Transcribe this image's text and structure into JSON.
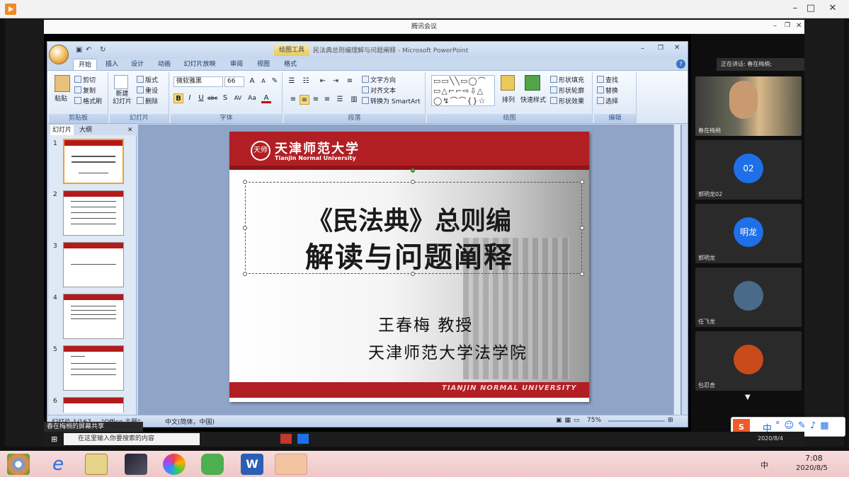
{
  "meeting": {
    "title": "腾讯会议"
  },
  "ppt": {
    "ctx_tab": "绘图工具",
    "doc_title": "民法典总则编理解与问题阐释 - Microsoft PowerPoint",
    "tabs": [
      "开始",
      "插入",
      "设计",
      "动画",
      "幻灯片放映",
      "审阅",
      "视图",
      "格式"
    ],
    "clipboard": {
      "paste": "粘贴",
      "cut": "剪切",
      "copy": "复制",
      "painter": "格式刷",
      "label": "剪贴板"
    },
    "slides": {
      "new": "新建\n幻灯片",
      "layout": "版式",
      "reset": "重设",
      "delete": "删除",
      "label": "幻灯片"
    },
    "font": {
      "name": "微软雅黑",
      "size": "66",
      "label": "字体"
    },
    "paragraph": {
      "dir": "文字方向",
      "align": "对齐文本",
      "smartart": "转换为 SmartArt",
      "label": "段落"
    },
    "drawing": {
      "arrange": "排列",
      "quick": "快速样式",
      "fill": "形状填充",
      "outline": "形状轮廓",
      "effect": "形状效果",
      "label": "绘图"
    },
    "editing": {
      "find": "查找",
      "replace": "替换",
      "select": "选择",
      "label": "编辑"
    },
    "panel_tabs": [
      "幻灯片",
      "大纲"
    ],
    "thumbs": [
      "1",
      "2",
      "3",
      "4",
      "5",
      "6"
    ],
    "status": {
      "slide": "幻灯片 1/167",
      "theme": "\"Office 主题\"",
      "lang": "中文(简体，中国)",
      "zoom": "75%"
    }
  },
  "slide": {
    "seal": "天师",
    "uni_cn": "天津师范大学",
    "uni_en": "Tianjin Normal University",
    "title1": "《民法典》总则编",
    "title2": "解读与问题阐释",
    "author": "王春梅  教授",
    "dept": "天津师范大学法学院",
    "footer": "TIANJIN NORMAL UNIVERSITY"
  },
  "sharer": "春在梅梢的屏幕共享",
  "speaking": "正在讲话: 春在梅梢;",
  "participants": [
    {
      "name": "春在梅梢",
      "avatar": ""
    },
    {
      "name": "郭明龙02",
      "avatar": "02",
      "color": "#1e6fe8"
    },
    {
      "name": "郭明龙",
      "avatar": "明龙",
      "color": "#1e6fe8"
    },
    {
      "name": "任飞龙",
      "avatar": "",
      "color": "#4a6a8a"
    },
    {
      "name": "包忍舍",
      "avatar": "",
      "color": "#c94a1a"
    }
  ],
  "inner_task": {
    "search": "在这里输入你要搜索的内容",
    "date": "2020/8/4"
  },
  "taskbar": {
    "time": "7:08",
    "date": "2020/8/5",
    "ime": "中"
  }
}
